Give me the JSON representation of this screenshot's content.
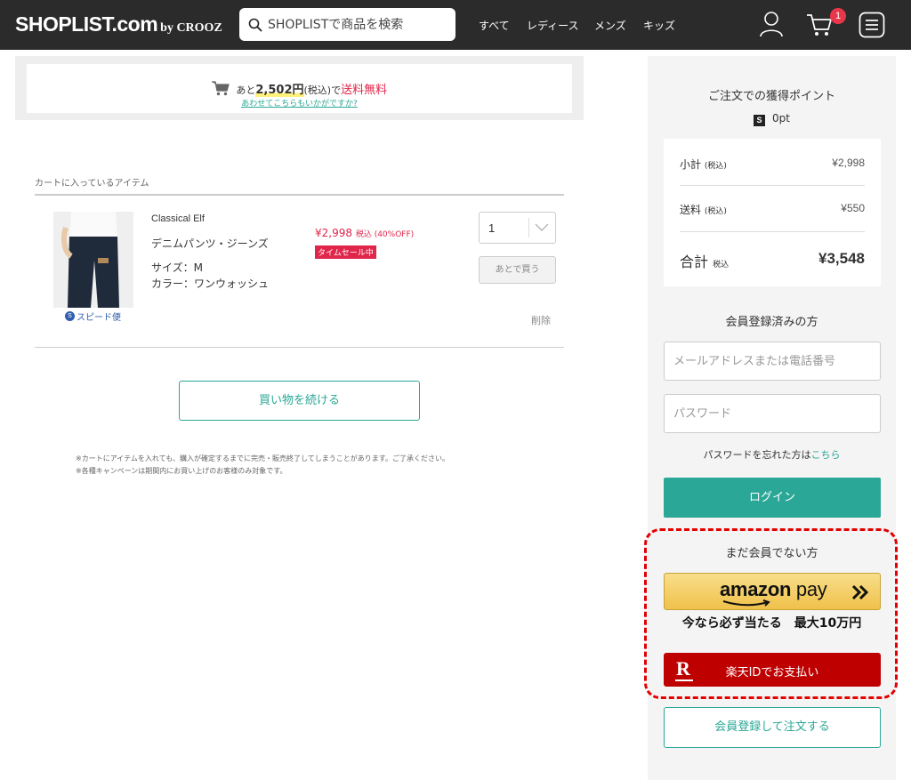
{
  "header": {
    "logo": "SHOPLIST.com",
    "logo_by": "by CROOZ",
    "search_placeholder": "SHOPLISTで商品を検索",
    "nav": [
      "すべて",
      "レディース",
      "メンズ",
      "キッズ"
    ],
    "cart_count": "1",
    "icons": [
      "user-icon",
      "cart-icon",
      "menu-icon"
    ]
  },
  "shipping": {
    "prefix": "あと",
    "amount": "2,502円",
    "tax": "(税込)",
    "middle": "で",
    "free": "送料無料",
    "link": "あわせてこちらもいかがですか?"
  },
  "cart": {
    "section_label": "カートに入っているアイテム",
    "item": {
      "brand": "Classical Elf",
      "name": "デニムパンツ・ジーンズ",
      "size": "サイズ：M",
      "color": "カラー：ワンウォッシュ",
      "price": "¥2,998",
      "price_tax": "税込 (40%OFF)",
      "sale_tag": "タイムセール中",
      "speed": "スピード便",
      "speed_icon": "S",
      "qty": "1",
      "later": "あとで買う",
      "delete": "削除"
    },
    "continue": "買い物を続ける",
    "notes": [
      "※カートにアイテムを入れても、購入が確定するまでに完売・販売終了してしまうことがあります。ご了承ください。",
      "※各種キャンペーンは期間内にお買い上げのお客様のみ対象です。"
    ]
  },
  "summary": {
    "points_title": "ご注文での獲得ポイント",
    "points_icon": "S",
    "points": "0pt",
    "subtotal_label": "小計",
    "subtotal_tax": "(税込)",
    "subtotal": "¥2,998",
    "shipping_label": "送料",
    "shipping_tax": "(税込)",
    "shipping": "¥550",
    "total_label": "合計",
    "total_tax": "税込",
    "total": "¥3,548"
  },
  "login": {
    "heading": "会員登録済みの方",
    "email_placeholder": "メールアドレスまたは電話番号",
    "password_placeholder": "パスワード",
    "forgot_text": "パスワードを忘れた方は",
    "forgot_link": "こちら",
    "button": "ログイン"
  },
  "guest": {
    "heading": "まだ会員でない方",
    "amazon_label_a": "amazon",
    "amazon_label_b": " pay",
    "promo": "今なら必ず当たる　最大10万円",
    "rakuten_logo": "R",
    "rakuten": "楽天IDでお支払い",
    "register": "会員登録して注文する"
  },
  "colors": {
    "accent": "#2aa796",
    "sale": "#e0264a",
    "header_bg": "#2b2b2b",
    "rakuten": "#bf0000",
    "highlight_border": "#e30000"
  }
}
